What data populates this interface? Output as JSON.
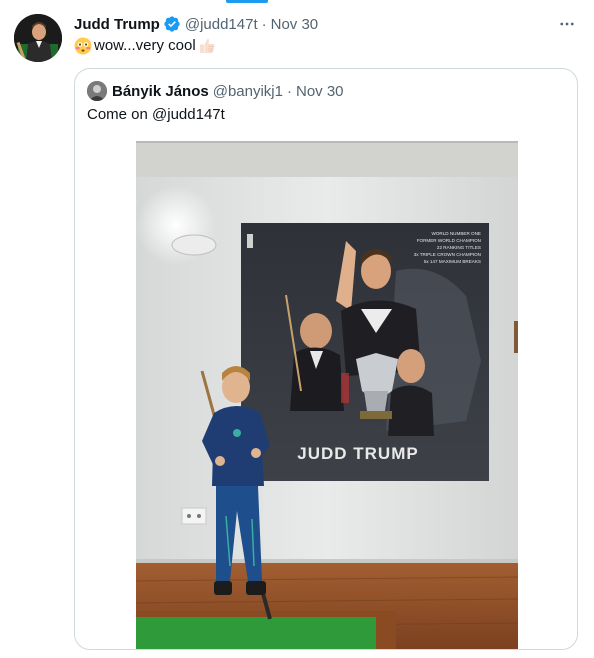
{
  "tweet": {
    "author": {
      "name": "Judd Trump",
      "handle": "@judd147t",
      "avatar": "avatar-image"
    },
    "separator": "·",
    "date": "Nov 30",
    "text": "wow...very cool",
    "emojis": [
      "flushed-face-emoji",
      "thumbs-up-emoji"
    ],
    "more_icon": "more-horizontal-icon",
    "verified_icon": "verified-badge-icon",
    "quoted": {
      "author": {
        "name": "Bányik János",
        "handle": "@banyikj1",
        "avatar": "avatar-image"
      },
      "separator": "·",
      "date": "Nov 30",
      "text": "Come on @judd147t",
      "media": {
        "type": "photo",
        "poster": {
          "title": "JUDD TRUMP",
          "lines": [
            "WORLD NUMBER ONE",
            "FORMER WORLD CHAMPION",
            "22 RANKING TITLES",
            "3x TRIPLE CROWN CHAMPION",
            "5x 147 MAXIMUM BREAKS"
          ]
        }
      }
    }
  },
  "colors": {
    "accent": "#1d9bf0",
    "text": "#0f1419",
    "secondary": "#536471",
    "border": "#cfd9de"
  }
}
